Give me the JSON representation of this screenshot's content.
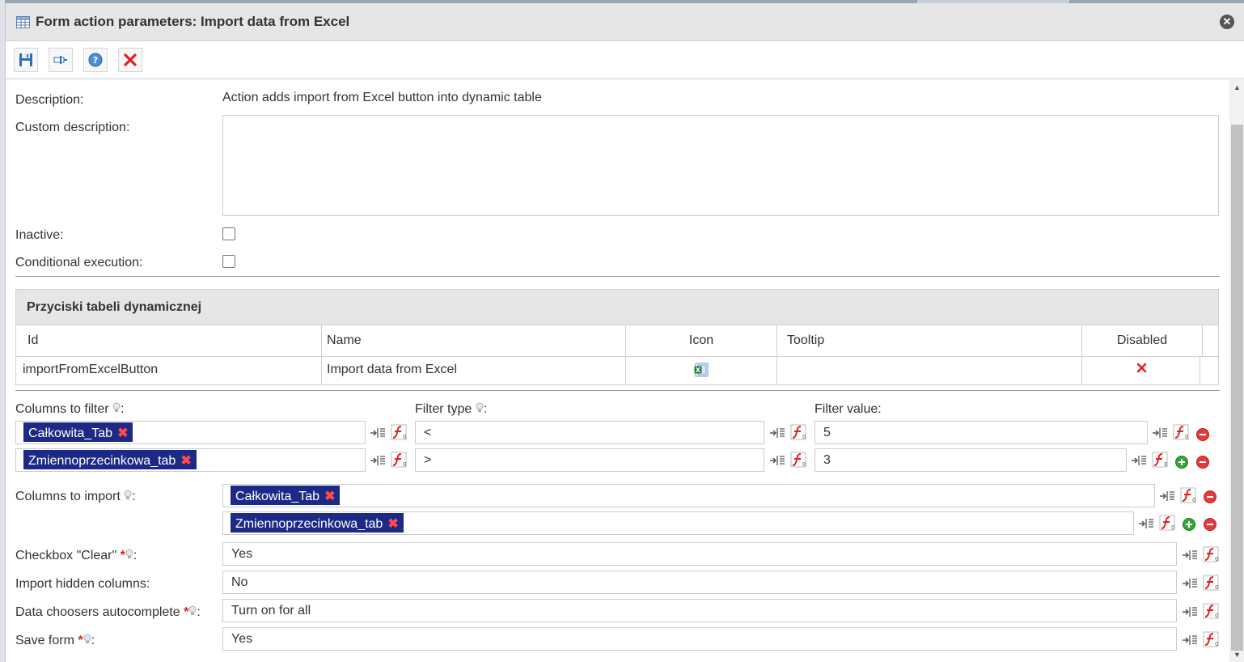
{
  "window": {
    "title": "Form action parameters: Import data from Excel"
  },
  "toolbar": {
    "buttons": [
      "save-icon",
      "variable-icon",
      "help-icon",
      "delete-icon"
    ]
  },
  "form": {
    "description_label": "Description:",
    "description_value": "Action adds import from Excel button into dynamic table",
    "custom_description_label": "Custom description:",
    "custom_description_value": "",
    "inactive_label": "Inactive:",
    "conditional_label": "Conditional execution:"
  },
  "buttons_table": {
    "title": "Przyciski tabeli dynamicznej",
    "columns": [
      "Id",
      "Name",
      "Icon",
      "Tooltip",
      "Disabled"
    ],
    "rows": [
      {
        "id": "importFromExcelButton",
        "name": "Import data from Excel",
        "icon": "excel-icon",
        "tooltip": "",
        "disabled": false
      }
    ]
  },
  "filters": {
    "columns_label": "Columns to filter",
    "type_label": "Filter type",
    "value_label": "Filter value:",
    "rows": [
      {
        "column": "Całkowita_Tab",
        "type": "<",
        "value": "5"
      },
      {
        "column": "Zmiennoprzecinkowa_tab",
        "type": ">",
        "value": "3"
      }
    ]
  },
  "import": {
    "label": "Columns to import",
    "columns": [
      "Całkowita_Tab",
      "Zmiennoprzecinkowa_tab"
    ]
  },
  "settings": {
    "clear_label": "Checkbox \"Clear\"",
    "clear_value": "Yes",
    "hidden_label": "Import hidden columns:",
    "hidden_value": "No",
    "autocomplete_label": "Data choosers autocomplete",
    "autocomplete_value": "Turn on for all",
    "save_label": "Save form",
    "save_value": "Yes"
  },
  "colors": {
    "tag_bg": "#1c2a85",
    "required": "#e02020",
    "header_bg": "#e6e6e6"
  }
}
